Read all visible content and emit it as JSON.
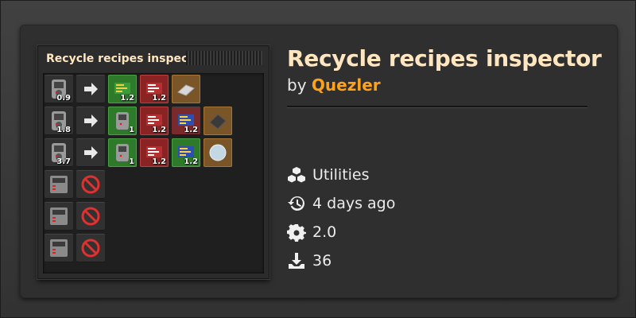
{
  "inspector": {
    "title": "Recycle recipes inspector",
    "rows": [
      {
        "input_count": "0.9",
        "outputs": [
          "1.2",
          "1.2",
          ""
        ]
      },
      {
        "input_count": "1.8",
        "outputs": [
          "1",
          "1.2",
          "1.2",
          ""
        ]
      },
      {
        "input_count": "3.7",
        "outputs": [
          "1",
          "1.2",
          "1.2",
          ""
        ]
      },
      {
        "input_count": "",
        "outputs": []
      },
      {
        "input_count": "",
        "outputs": []
      },
      {
        "input_count": "",
        "outputs": []
      }
    ]
  },
  "mod": {
    "title": "Recycle recipes inspector",
    "by": "by",
    "author": "Quezler"
  },
  "meta": {
    "category": "Utilities",
    "updated": "4 days ago",
    "version": "2.0",
    "downloads": "36"
  },
  "colors": {
    "title": "#ffe6c0",
    "author": "#ffa21b",
    "background": "#2f2f2f"
  }
}
